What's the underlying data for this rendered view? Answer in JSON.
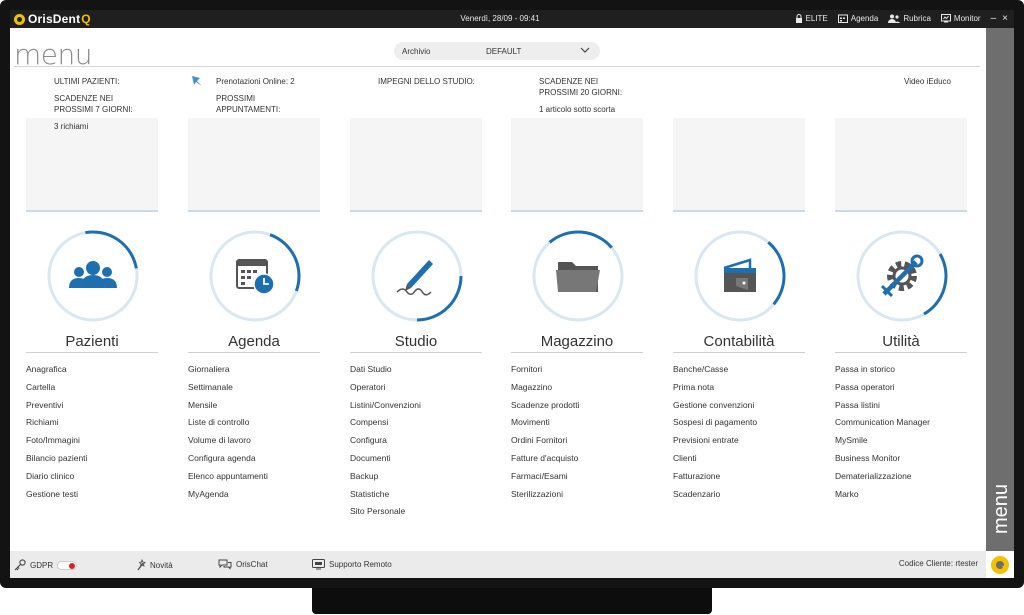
{
  "titlebar": {
    "app_name": "OrisDent",
    "app_suffix": "Q",
    "datetime": "Venerdì, 28/09 - 09:41",
    "elite": "ELITE",
    "agenda": "Agenda",
    "rubrica": "Rubrica",
    "monitor": "Monitor",
    "minimize": "–",
    "close": "×"
  },
  "page": {
    "title": "menu",
    "archive_label": "Archivio",
    "archive_value": "DEFAULT"
  },
  "panels": [
    {
      "lines": [
        "ULTIMI PAZIENTI:",
        "",
        "SCADENZE NEI",
        "PROSSIMI 7 GIORNI:",
        "",
        "3 richiami"
      ]
    },
    {
      "lines": [
        "Prenotazioni Online: 2",
        "",
        "PROSSIMI",
        "APPUNTAMENTI:"
      ]
    },
    {
      "lines": [
        "IMPEGNI DELLO STUDIO:"
      ]
    },
    {
      "lines": [
        "SCADENZE NEI",
        "PROSSIMI 20 GIORNI:",
        "",
        "1 articolo sotto scorta"
      ]
    },
    {
      "lines": []
    },
    {
      "lines": [
        "Video iEduco"
      ]
    }
  ],
  "modules": [
    {
      "title": "Pazienti",
      "icon": "patients-icon",
      "links": [
        "Anagrafica",
        "Cartella",
        "Preventivi",
        "Richiami",
        "Foto/Immagini",
        "Bilancio pazienti",
        "Diario clinico",
        "Gestione testi"
      ]
    },
    {
      "title": "Agenda",
      "icon": "calendar-clock-icon",
      "links": [
        "Giornaliera",
        "Settimanale",
        "Mensile",
        "Liste di controllo",
        "Volume di lavoro",
        "Configura agenda",
        "Elenco appuntamenti",
        "MyAgenda"
      ]
    },
    {
      "title": "Studio",
      "icon": "pen-signature-icon",
      "links": [
        "Dati Studio",
        "Operatori",
        "Listini/Convenzioni",
        "Compensi",
        "Configura",
        "Documenti",
        "Backup",
        "Statistiche",
        "Sito Personale"
      ]
    },
    {
      "title": "Magazzino",
      "icon": "folder-icon",
      "links": [
        "Fornitori",
        "Magazzino",
        "Scadenze prodotti",
        "Movimenti",
        "Ordini Fornitori",
        "Fatture d'acquisto",
        "Farmaci/Esami",
        "Sterilizzazioni"
      ]
    },
    {
      "title": "Contabilità",
      "icon": "wallet-icon",
      "links": [
        "Banche/Casse",
        "Prima nota",
        "Gestione convenzioni",
        "Sospesi di pagamento",
        "Previsioni entrate",
        "Clienti",
        "Fatturazione",
        "Scadenzario"
      ]
    },
    {
      "title": "Utilità",
      "icon": "gear-wrench-icon",
      "links": [
        "Passa in storico",
        "Passa operatori",
        "Passa listini",
        "Communication Manager",
        "MySmile",
        "Business Monitor",
        "Dematerializzazione",
        "Marko"
      ]
    }
  ],
  "footer": {
    "gdpr": "GDPR",
    "novita": "Novità",
    "orischat": "OrisChat",
    "supporto": "Supporto Remoto",
    "client": "Codice Cliente: rtester"
  },
  "sidebar": {
    "label": "menu"
  },
  "colors": {
    "accent": "#1e6fb0",
    "brand_yellow": "#f2c200",
    "titlebar": "#1f1f1f",
    "sidebar": "#6e6e6e"
  }
}
